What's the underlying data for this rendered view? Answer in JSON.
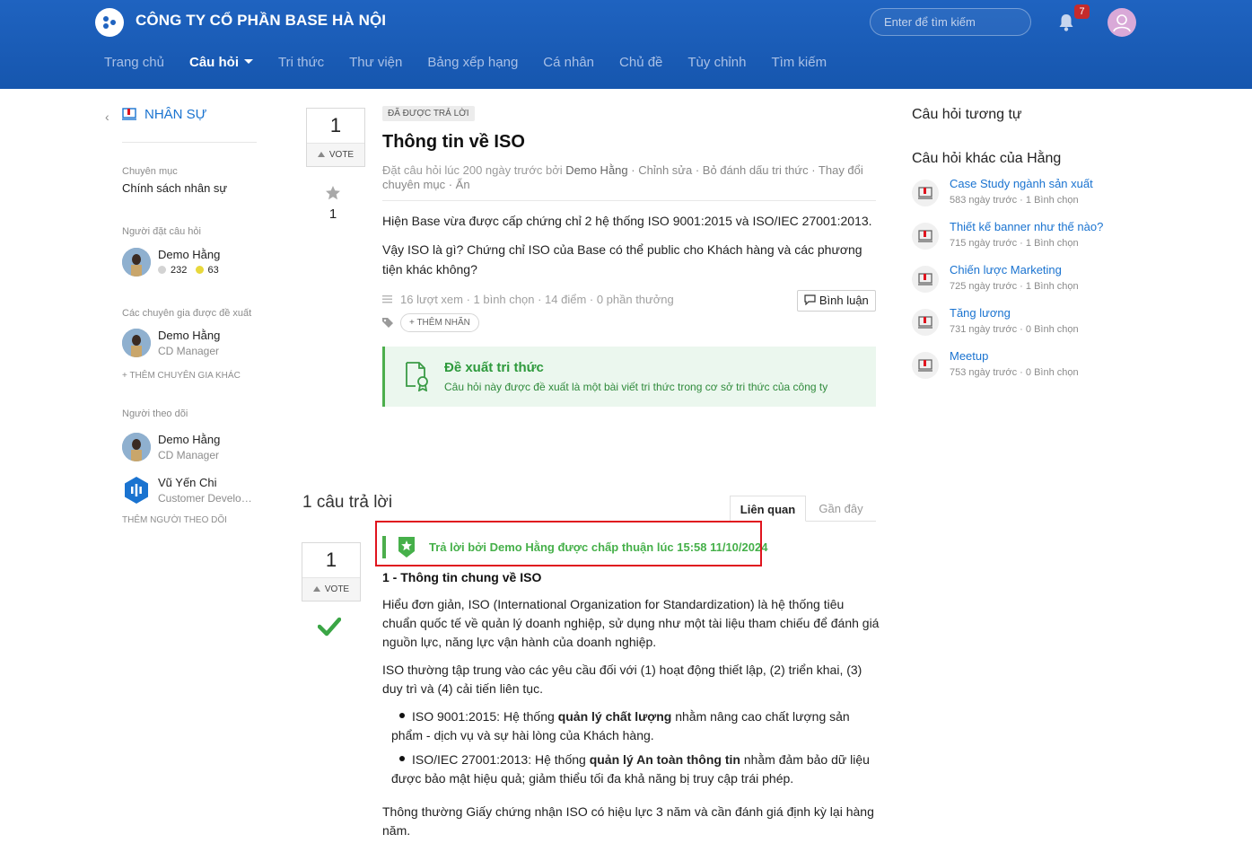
{
  "header": {
    "company": "CÔNG TY CỔ PHẦN BASE HÀ NỘI",
    "search_placeholder": "Enter để tìm kiếm",
    "notification_count": "7",
    "nav": [
      "Trang chủ",
      "Câu hỏi",
      "Tri thức",
      "Thư viện",
      "Bảng xếp hạng",
      "Cá nhân",
      "Chủ đề",
      "Tùy chỉnh",
      "Tìm kiếm"
    ],
    "nav_active": "Câu hỏi"
  },
  "sidebar": {
    "back": "‹",
    "department": "NHÂN SỰ",
    "category_label": "Chuyên mục",
    "category": "Chính sách nhân sự",
    "asker_label": "Người đặt câu hỏi",
    "asker": {
      "name": "Demo Hằng",
      "points_gray": "232",
      "points_gold": "63"
    },
    "experts_label": "Các chuyên gia được đề xuất",
    "expert": {
      "name": "Demo Hằng",
      "title": "CD Manager"
    },
    "add_expert": "+ THÊM CHUYÊN GIA KHÁC",
    "followers_label": "Người theo dõi",
    "followers": [
      {
        "name": "Demo Hằng",
        "title": "CD Manager"
      },
      {
        "name": "Vũ Yến Chi",
        "title": "Customer Development"
      }
    ],
    "add_follower": "THÊM NGƯỜI THEO DÕI"
  },
  "question": {
    "votes": "1",
    "vote_label": "VOTE",
    "star_count": "1",
    "status": "ĐÃ ĐƯỢC TRẢ LỜI",
    "title": "Thông tin về ISO",
    "meta_prefix": "Đặt câu hỏi lúc 200 ngày trước bởi",
    "meta_author": "Demo Hằng",
    "meta_actions": "· Chỉnh sửa · Bỏ đánh dấu tri thức · Thay đổi chuyên mục · Ẩn",
    "body": [
      "Hiện Base vừa được cấp chứng chỉ 2 hệ thống ISO 9001:2015 và ISO/IEC 27001:2013.",
      "Vậy ISO là gì? Chứng chỉ ISO của Base có thể public cho Khách hàng và các phương tiện khác không?"
    ],
    "stats": "16 lượt xem · 1 bình chọn · 14 điểm · 0 phần thưởng",
    "comment_button": "Bình luận",
    "add_tag": "+ THÊM NHÃN",
    "suggest_title": "Đề xuất tri thức",
    "suggest_sub": "Câu hỏi này được đề xuất là một bài viết tri thức trong cơ sở tri thức của công ty"
  },
  "answers": {
    "count_label": "1 câu trả lời",
    "tab_related": "Liên quan",
    "tab_recent": "Gần đây",
    "votes": "1",
    "vote_label": "VOTE",
    "accepted": "Trả lời bởi Demo Hằng được chấp thuận lúc 15:58 11/10/2024",
    "heading": "1 - Thông tin chung về ISO",
    "p1": "Hiểu đơn giản, ISO (International Organization for Standardization) là hệ thống tiêu chuẩn quốc tế về quản lý doanh nghiệp, sử dụng như một tài liệu tham chiếu để đánh giá nguồn lực, năng lực vận hành của doanh nghiệp.",
    "p2": "ISO thường tập trung vào các yêu cầu đối với (1) hoạt động thiết lập, (2) triển khai, (3) duy trì và (4) cải tiến liên tục.",
    "li1_a": "ISO 9001:2015: Hệ thống ",
    "li1_b": "quản lý chất lượng",
    "li1_c": " nhằm nâng cao chất lượng sản phẩm - dịch vụ và sự hài lòng của Khách hàng.",
    "li2_a": "ISO/IEC 27001:2013: Hệ thống ",
    "li2_b": "quản lý An toàn thông tin",
    "li2_c": " nhằm đảm bảo dữ liệu được bảo mật hiệu quả; giảm thiểu tối đa khả năng bị truy cập trái phép.",
    "p3": "Thông thường Giấy chứng nhận ISO có hiệu lực 3 năm và cần đánh giá định kỳ lại hàng năm."
  },
  "right": {
    "similar_heading": "Câu hỏi tương tự",
    "other_heading": "Câu hỏi khác của Hằng",
    "items": [
      {
        "title": "Case Study ngành sản xuất",
        "meta": "583 ngày trước · 1 Bình chọn"
      },
      {
        "title": "Thiết kế banner như thế nào?",
        "meta": "715 ngày trước · 1 Bình chọn"
      },
      {
        "title": "Chiến lược Marketing",
        "meta": "725 ngày trước · 1 Bình chọn"
      },
      {
        "title": "Tăng lương",
        "meta": "731 ngày trước · 0 Bình chọn"
      },
      {
        "title": "Meetup",
        "meta": "753 ngày trước · 0 Bình chọn"
      }
    ]
  },
  "colors": {
    "header": "#1f63c0",
    "link": "#1a73d0",
    "success": "#46b04a",
    "highlight": "#e0141e"
  }
}
